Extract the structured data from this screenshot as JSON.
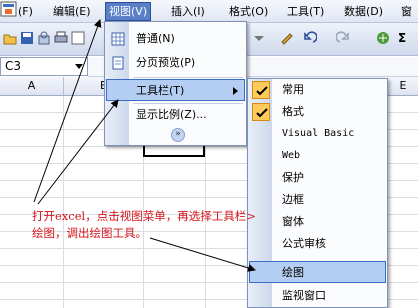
{
  "menubar": {
    "items": [
      {
        "label": "(F)",
        "state": "normal"
      },
      {
        "label": "编辑(E)",
        "state": "normal"
      },
      {
        "label": "视图(V)",
        "state": "open"
      },
      {
        "label": "插入(I)",
        "state": "normal"
      },
      {
        "label": "格式(O)",
        "state": "normal"
      },
      {
        "label": "工具(T)",
        "state": "normal"
      },
      {
        "label": "数据(D)",
        "state": "normal"
      },
      {
        "label": "窗",
        "state": "normal"
      }
    ]
  },
  "namebox": {
    "value": "C3"
  },
  "columns": [
    "A",
    "B",
    "E"
  ],
  "view_menu": {
    "items": [
      {
        "label": "普通(N)",
        "icon": "normal-view-icon"
      },
      {
        "label": "分页预览(P)",
        "icon": "page-break-preview-icon"
      },
      {
        "label": "工具栏(T)",
        "highlighted": true,
        "has_submenu": true
      },
      {
        "label": "显示比例(Z)..."
      }
    ],
    "expand_glyph": "»"
  },
  "toolbars_submenu": {
    "items": [
      {
        "label": "常用",
        "checked": true
      },
      {
        "label": "格式",
        "checked": true
      },
      {
        "label": "Visual Basic",
        "checked": false
      },
      {
        "label": "Web",
        "checked": false
      },
      {
        "label": "保护",
        "checked": false
      },
      {
        "label": "边框",
        "checked": false
      },
      {
        "label": "窗体",
        "checked": false
      },
      {
        "label": "公式审核",
        "checked": false
      },
      {
        "label": "绘图",
        "checked": false,
        "highlighted": true
      },
      {
        "label": "监视窗口",
        "checked": false
      }
    ]
  },
  "annotation": {
    "text": "打开excel，点击视图菜单，再选择工具栏>绘图，调出绘图工具。",
    "color": "#d4141a"
  },
  "colors": {
    "accent": "#5a7fc6",
    "highlight": "#b4cdf3",
    "check": "#ffca5c"
  }
}
